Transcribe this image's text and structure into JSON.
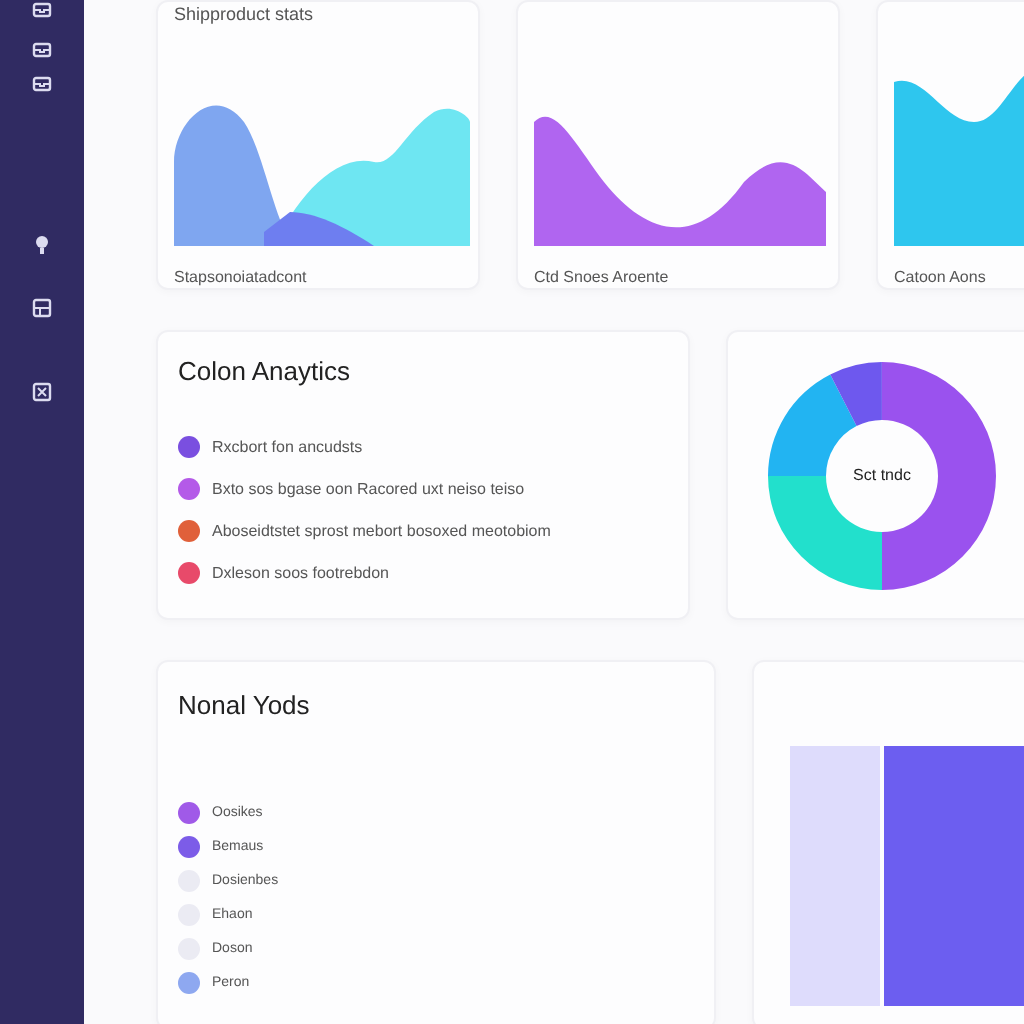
{
  "sidebar": {
    "icons": [
      {
        "kind": "tray"
      },
      {
        "kind": "tray"
      },
      {
        "kind": "tray"
      },
      {
        "kind": "bulb"
      },
      {
        "kind": "panel"
      },
      {
        "kind": "box"
      }
    ]
  },
  "top_cards": [
    {
      "kind": "dual",
      "heading": "Shipproduct stats",
      "caption": "Stapsonoiatadcont"
    },
    {
      "kind": "valley",
      "caption": "Ctd Snoes Aroente"
    },
    {
      "kind": "cut",
      "caption": "Catoon Aons"
    }
  ],
  "analytics": {
    "title": "Colon Anaytics",
    "items": [
      {
        "color": "#7a4fe0",
        "text": "Rxcbort fon ancudsts"
      },
      {
        "color": "#b45ae8",
        "text": "Bxto sos bgase oon Racored uxt neiso teiso"
      },
      {
        "color": "#e0603a",
        "text": "Aboseidtstet sprost mebort bosoxed meotobiom"
      },
      {
        "color": "#e84a6a",
        "text": "Dxleson soos footrebdon"
      }
    ]
  },
  "donut": {
    "center": "Sct tndc"
  },
  "legend": {
    "title": "Nonal Yods",
    "items": [
      {
        "color": "#a05ae8",
        "text": "Oosikes"
      },
      {
        "color": "#7c5ce8",
        "text": "Bemaus"
      },
      {
        "color": "#ebebf3",
        "text": "Dosienbes"
      },
      {
        "color": "#ebebf3",
        "text": "Ehaon"
      },
      {
        "color": "#ebebf3",
        "text": "Doson"
      },
      {
        "color": "#8ea8f0",
        "text": "Peron"
      }
    ]
  }
}
